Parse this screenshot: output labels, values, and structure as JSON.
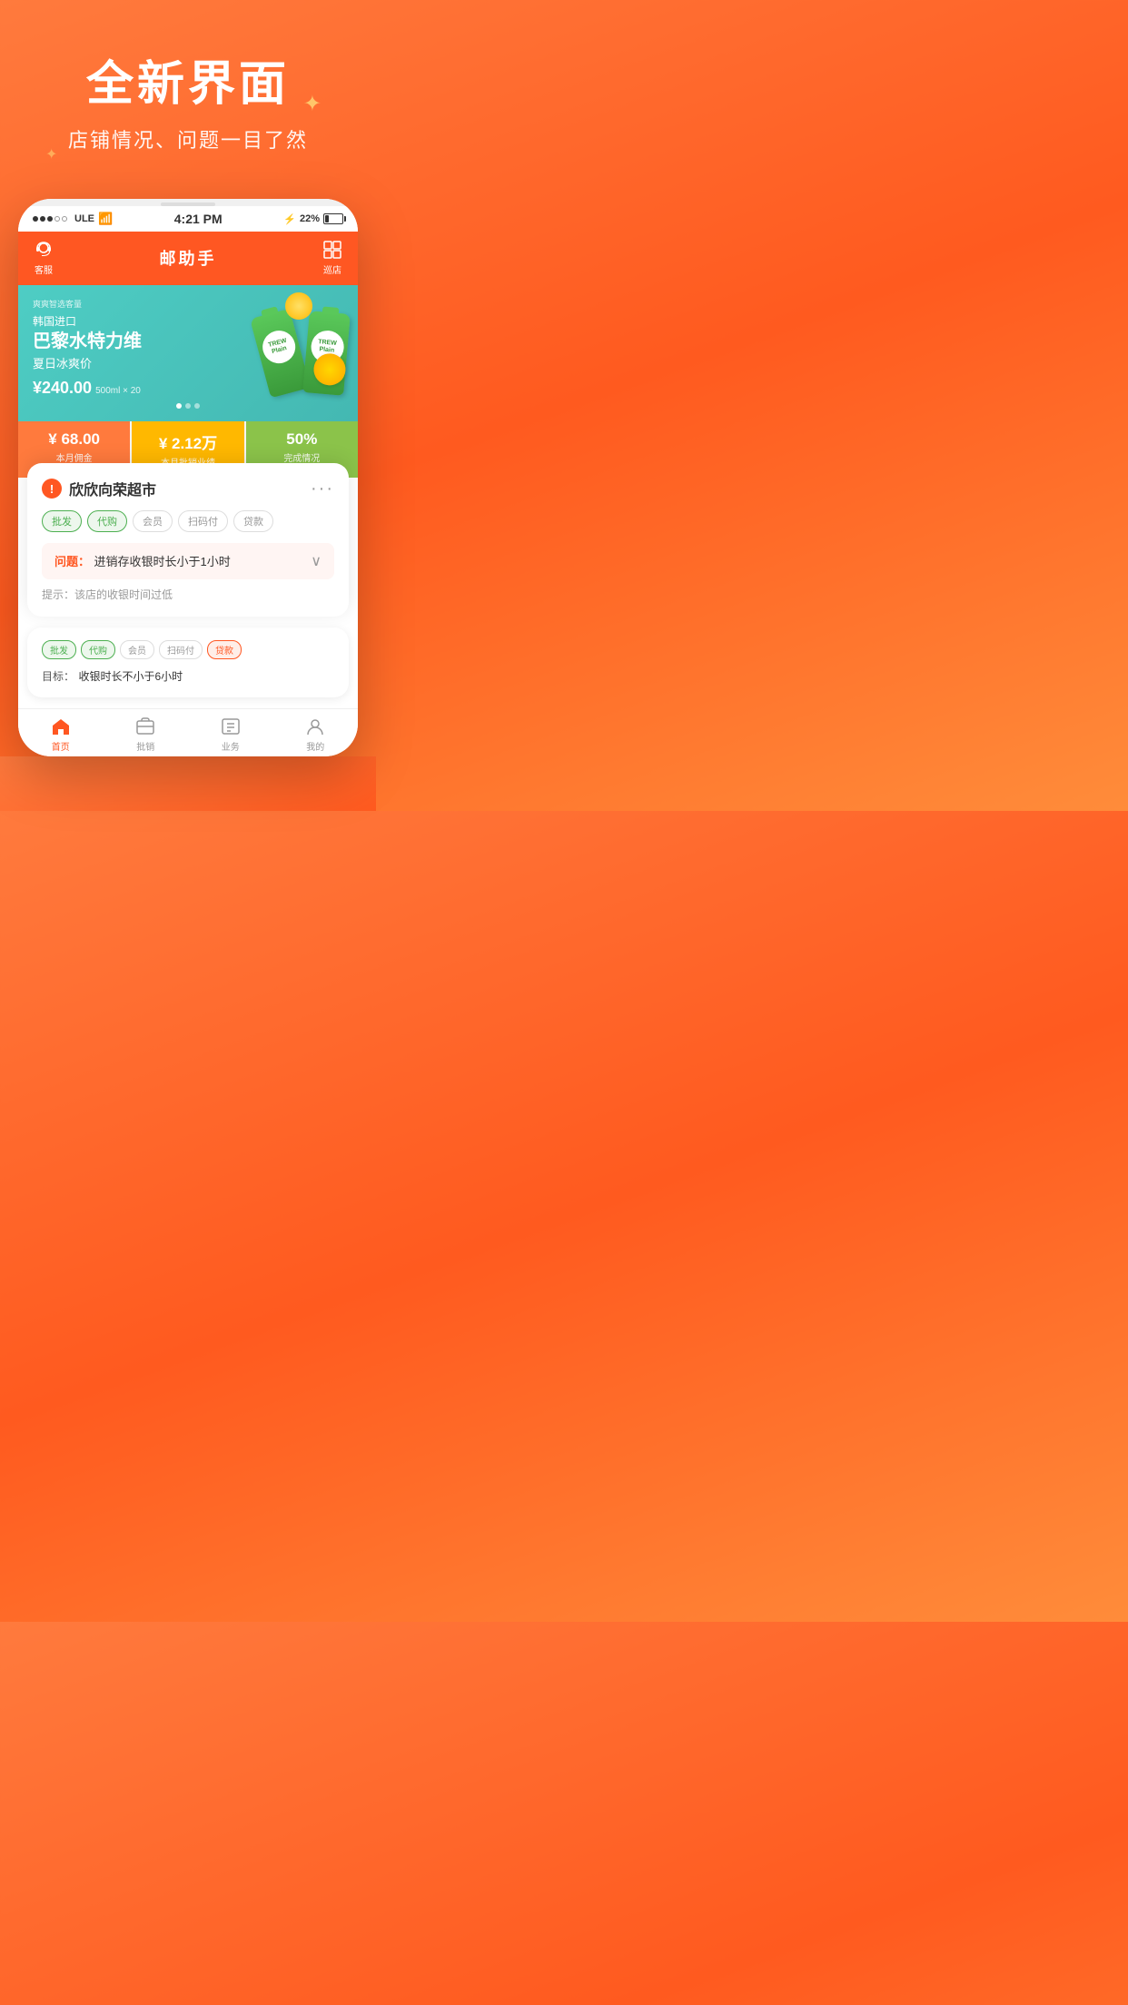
{
  "hero": {
    "title": "全新界面",
    "subtitle": "店铺情况、问题一目了然"
  },
  "statusBar": {
    "carrier": "ULE",
    "time": "4:21 PM",
    "bluetooth": "22%"
  },
  "appHeader": {
    "leftLabel": "客服",
    "title": "邮助手",
    "rightLabel": "巡店"
  },
  "banner": {
    "tag": "爽爽智选客量",
    "subtitle": "韩国进口",
    "title": "巴黎水特力维",
    "desc": "夏日冰爽价",
    "price": "¥240.00",
    "unit": "500ml × 20",
    "bottle1Label": "TREW",
    "bottle2Label": "TREW"
  },
  "stats": [
    {
      "value": "¥ 68.00",
      "label": "本月佣金"
    },
    {
      "value": "¥ 2.12万",
      "label": "本月批销业绩"
    },
    {
      "value": "50%",
      "label": "完成情况"
    }
  ],
  "card1": {
    "alertIcon": "!",
    "title": "欣欣向荣超市",
    "more": "···",
    "tags": [
      {
        "label": "批发",
        "style": "active-green"
      },
      {
        "label": "代购",
        "style": "active-green"
      },
      {
        "label": "会员",
        "style": "plain"
      },
      {
        "label": "扫码付",
        "style": "plain"
      },
      {
        "label": "贷款",
        "style": "plain"
      }
    ],
    "issueLabel": "问题：",
    "issueText": "进销存收银时长小于1小时",
    "hint": "提示：该店的收银时间过低"
  },
  "card2": {
    "tags": [
      {
        "label": "批发",
        "style": "active-green"
      },
      {
        "label": "代购",
        "style": "active-green"
      },
      {
        "label": "会员",
        "style": "plain"
      },
      {
        "label": "扫码付",
        "style": "plain"
      },
      {
        "label": "贷款",
        "style": "active-orange"
      }
    ],
    "goalLabel": "目标：",
    "goalText": "收银时长不小于6小时"
  },
  "bottomNav": [
    {
      "label": "首页",
      "active": true
    },
    {
      "label": "批销",
      "active": false
    },
    {
      "label": "业务",
      "active": false
    },
    {
      "label": "我的",
      "active": false
    }
  ]
}
